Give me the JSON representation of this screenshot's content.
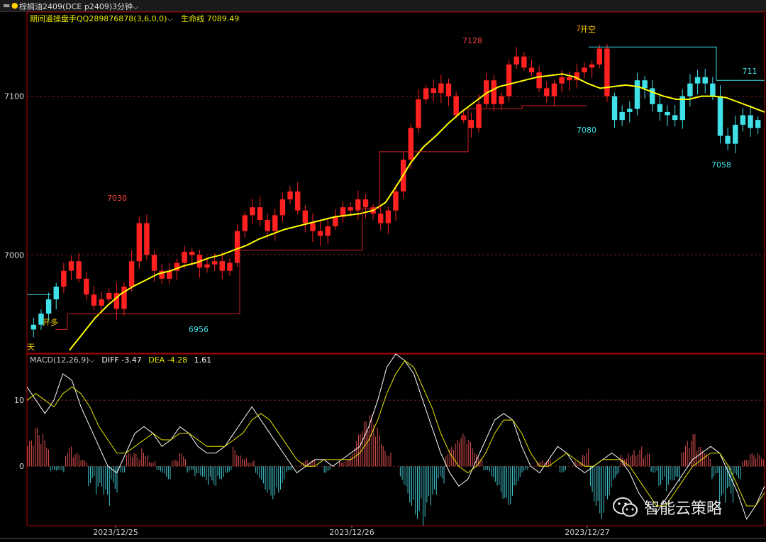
{
  "window": {
    "instrument": "棕榈油2409(DCE p2409)",
    "period": "3分钟"
  },
  "colors": {
    "up": "#ff2020",
    "down": "#40e0e8",
    "ma": "#ffff00",
    "frame": "#b00000",
    "grid": "#802020",
    "diff": "#ffffff",
    "dea": "#e8e800",
    "stopline": "#d02020",
    "levelline": "#40e0e8"
  },
  "indicator": {
    "name": "期间道操盘手QQ289876878(3,6,0,0)",
    "lifeline_label": "生命线",
    "lifeline_value": "7089.49"
  },
  "macd": {
    "name": "MACD(12,26,9)",
    "diff_label": "DIFF",
    "diff_value": "-3.47",
    "dea_label": "DEA",
    "dea_value": "-4.28",
    "macd_value": "1.61"
  },
  "chart_data": [
    {
      "type": "candlestick",
      "title": "",
      "y_ticks": [
        "7100",
        "7000"
      ],
      "ylim": [
        6938,
        7153
      ],
      "x_ticks": [
        "2023/12/25",
        "2023/12/26",
        "2023/12/27"
      ],
      "annotations": [
        {
          "text": "7030",
          "value": 7030
        },
        {
          "text": "6956",
          "value": 6956
        },
        {
          "text": "7128",
          "value": 7128
        },
        {
          "text": "7080",
          "value": 7080
        },
        {
          "text": "7058",
          "value": 7058
        },
        {
          "text": "711",
          "value": 7110
        },
        {
          "text": "开多"
        },
        {
          "text": "开空"
        },
        {
          "text": "7"
        },
        {
          "text": "天"
        }
      ],
      "close_series": [
        6956,
        6963,
        6972,
        6980,
        6990,
        6996,
        6985,
        6975,
        6968,
        6972,
        6976,
        6966,
        6980,
        6996,
        7020,
        7000,
        6990,
        6985,
        6990,
        6995,
        7002,
        7000,
        6992,
        6994,
        6996,
        6990,
        6995,
        7015,
        7025,
        7030,
        7022,
        7015,
        7025,
        7035,
        7040,
        7028,
        7020,
        7015,
        7012,
        7018,
        7024,
        7030,
        7028,
        7035,
        7030,
        7026,
        7020,
        7028,
        7040,
        7060,
        7080,
        7098,
        7105,
        7102,
        7108,
        7100,
        7088,
        7085,
        7080,
        7095,
        7110,
        7095,
        7100,
        7120,
        7125,
        7118,
        7115,
        7105,
        7100,
        7108,
        7112,
        7110,
        7115,
        7118,
        7120,
        7130,
        7100,
        7085,
        7090,
        7092,
        7110,
        7105,
        7095,
        7090,
        7088,
        7085,
        7100,
        7108,
        7112,
        7108,
        7100,
        7075,
        7070,
        7082,
        7088,
        7080,
        7085
      ],
      "ma_series": [
        6940,
        6950,
        6960,
        6968,
        6975,
        6980,
        6984,
        6988,
        6990,
        6993,
        6995,
        6998,
        7000,
        7003,
        7006,
        7010,
        7013,
        7016,
        7018,
        7020,
        7022,
        7024,
        7025,
        7026,
        7028,
        7033,
        7045,
        7058,
        7068,
        7075,
        7083,
        7090,
        7096,
        7102,
        7106,
        7108,
        7110,
        7112,
        7113,
        7114,
        7112,
        7108,
        7105,
        7106,
        7107,
        7106,
        7103,
        7100,
        7098,
        7098,
        7100,
        7100,
        7099,
        7096,
        7093,
        7090
      ],
      "series": [
        {
          "name": "生命线",
          "value": 7089.49
        }
      ]
    },
    {
      "type": "bar+line",
      "title": "MACD(12,26,9)",
      "y_ticks": [
        "10",
        "0"
      ],
      "ylim": [
        -9,
        17
      ],
      "histogram": [
        4,
        6,
        5,
        -1,
        -1,
        3,
        2,
        1,
        -3,
        -5,
        -7,
        -4,
        -1,
        2,
        2,
        3,
        1,
        -1,
        -2,
        1,
        2,
        -1,
        -2,
        -3,
        -3,
        -2,
        -1,
        3,
        2,
        1,
        -2,
        -4,
        -5,
        -4,
        -1,
        0,
        1,
        1,
        0,
        -1,
        0,
        1,
        2,
        5,
        7,
        8,
        6,
        3,
        0,
        -3,
        -6,
        -8,
        -9,
        -7,
        -3,
        3,
        4,
        5,
        4,
        2,
        -1,
        -3,
        -5,
        -6,
        -3,
        -1,
        0,
        1,
        1,
        0,
        -1,
        0,
        1,
        3,
        -6,
        -8,
        -5,
        -2,
        2,
        3,
        3,
        2,
        -1,
        -3,
        -4,
        -3,
        4,
        5,
        3,
        2,
        -2,
        -8,
        -6,
        -2,
        1,
        2,
        2
      ],
      "series": [
        {
          "name": "DIFF",
          "value": -3.47,
          "values": [
            12,
            10,
            8,
            10,
            14,
            13,
            9,
            6,
            3,
            0,
            -1,
            2,
            5,
            6,
            5,
            3,
            4,
            6,
            5,
            3,
            2,
            2,
            3,
            5,
            7,
            9,
            7,
            5,
            3,
            1,
            -1,
            0,
            1,
            1,
            0,
            1,
            2,
            3,
            6,
            10,
            15,
            17,
            16,
            14,
            10,
            6,
            2,
            -1,
            -3,
            -2,
            1,
            4,
            7,
            8,
            7,
            3,
            0,
            -1,
            1,
            3,
            2,
            0,
            -1,
            0,
            1,
            2,
            1,
            -1,
            -4,
            -6,
            -7,
            -5,
            -3,
            -1,
            1,
            2,
            3,
            2,
            -1,
            -4,
            -8,
            -6,
            -3
          ]
        },
        {
          "name": "DEA",
          "value": -4.28,
          "values": [
            10,
            11,
            10,
            9,
            11,
            12,
            11,
            9,
            6,
            4,
            2,
            2,
            3,
            4,
            5,
            4,
            4,
            5,
            5,
            4,
            3,
            3,
            3,
            4,
            5,
            7,
            8,
            7,
            5,
            3,
            1,
            0,
            0,
            1,
            1,
            1,
            1,
            2,
            4,
            7,
            11,
            14,
            16,
            15,
            12,
            9,
            5,
            2,
            0,
            -1,
            0,
            2,
            5,
            7,
            7,
            5,
            2,
            0,
            0,
            1,
            2,
            1,
            0,
            0,
            1,
            1,
            1,
            0,
            -2,
            -4,
            -6,
            -6,
            -4,
            -2,
            0,
            1,
            2,
            2,
            0,
            -3,
            -6,
            -6,
            -4
          ]
        }
      ]
    }
  ],
  "watermark": {
    "text": "智能云策略",
    "icon": "wechat-icon"
  }
}
